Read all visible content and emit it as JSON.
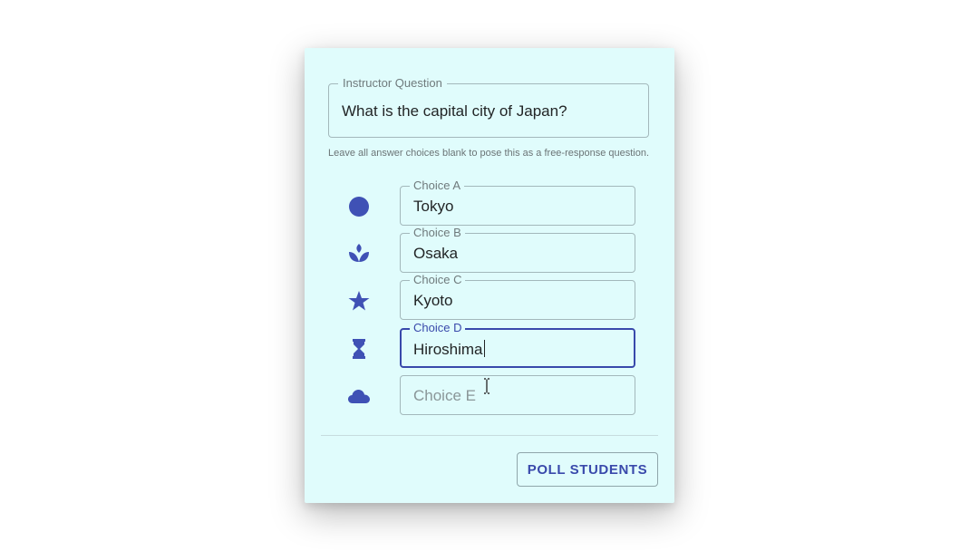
{
  "question": {
    "label": "Instructor Question",
    "value": "What is the capital city of Japan?"
  },
  "helper_text": "Leave all answer choices blank to pose this as a free-response question.",
  "choices": [
    {
      "label": "Choice A",
      "value": "Tokyo",
      "icon": "circle-icon"
    },
    {
      "label": "Choice B",
      "value": "Osaka",
      "icon": "lotus-icon"
    },
    {
      "label": "Choice C",
      "value": "Kyoto",
      "icon": "star-icon"
    },
    {
      "label": "Choice D",
      "value": "Hiroshima",
      "icon": "hourglass-icon",
      "focused": true
    },
    {
      "label": "",
      "placeholder": "Choice E",
      "value": "",
      "icon": "cloud-icon"
    }
  ],
  "actions": {
    "poll_label": "POLL STUDENTS"
  },
  "colors": {
    "accent": "#3949ab",
    "dialog_background": "#e0fcfc",
    "icon": "#3f51b5"
  }
}
